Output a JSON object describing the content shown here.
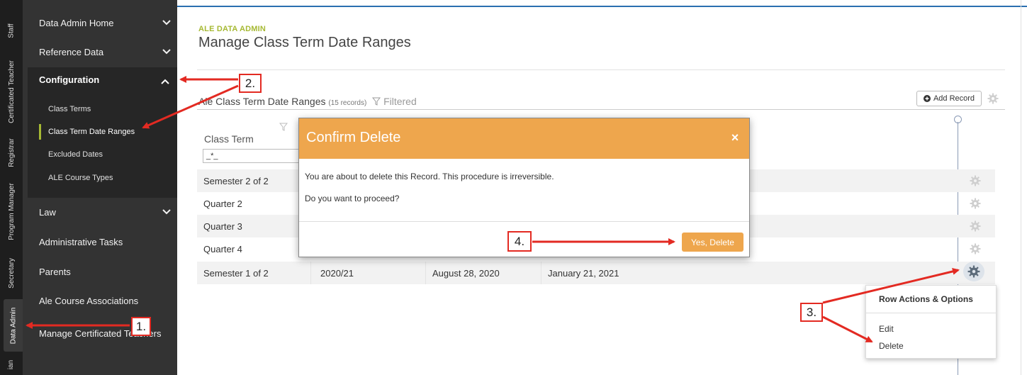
{
  "role_tabs": [
    "Staff",
    "Certificated Teacher",
    "Registrar",
    "Program Manager",
    "Secretary",
    "Data Admin",
    "ian"
  ],
  "sidebar": {
    "items": [
      {
        "label": "Data Admin Home"
      },
      {
        "label": "Reference Data"
      },
      {
        "label": "Law"
      },
      {
        "label": "Administrative Tasks"
      },
      {
        "label": "Parents"
      },
      {
        "label": "Ale Course Associations"
      },
      {
        "label": "Manage Certificated Teachers"
      }
    ],
    "config": {
      "label": "Configuration",
      "subitems": [
        "Class Terms",
        "Class Term Date Ranges",
        "Excluded Dates",
        "ALE Course Types"
      ]
    }
  },
  "page": {
    "eyebrow": "ALE DATA ADMIN",
    "title": "Manage Class Term Date Ranges"
  },
  "grid": {
    "title": "Ale Class Term Date Ranges",
    "records": "(15 records)",
    "filtered": "Filtered",
    "add_label": "Add Record",
    "column": "Class Term",
    "filter_value": "_*_",
    "rows": [
      {
        "term": "Semester 2 of 2",
        "year": "",
        "start": "",
        "end": ""
      },
      {
        "term": "Quarter 2",
        "year": "",
        "start": "",
        "end": ""
      },
      {
        "term": "Quarter 3",
        "year": "",
        "start": "",
        "end": ""
      },
      {
        "term": "Quarter 4",
        "year": "",
        "start": "",
        "end": ""
      },
      {
        "term": "Semester 1 of 2",
        "year": "2020/21",
        "start": "August 28, 2020",
        "end": "January 21, 2021"
      }
    ]
  },
  "modal": {
    "title": "Confirm Delete",
    "close": "×",
    "message1": "You are about to delete this Record. This procedure is irreversible.",
    "message2": "Do you want to proceed?",
    "confirm": "Yes, Delete"
  },
  "menu": {
    "title": "Row Actions & Options",
    "edit": "Edit",
    "delete": "Delete"
  },
  "annotations": {
    "step1": "1.",
    "step2": "2.",
    "step3": "3.",
    "step4": "4."
  },
  "colors": {
    "accent_orange": "#eea64d",
    "brand_green": "#a6b933",
    "annotation_red": "#e32a22",
    "sidebar_bg": "#333333"
  }
}
